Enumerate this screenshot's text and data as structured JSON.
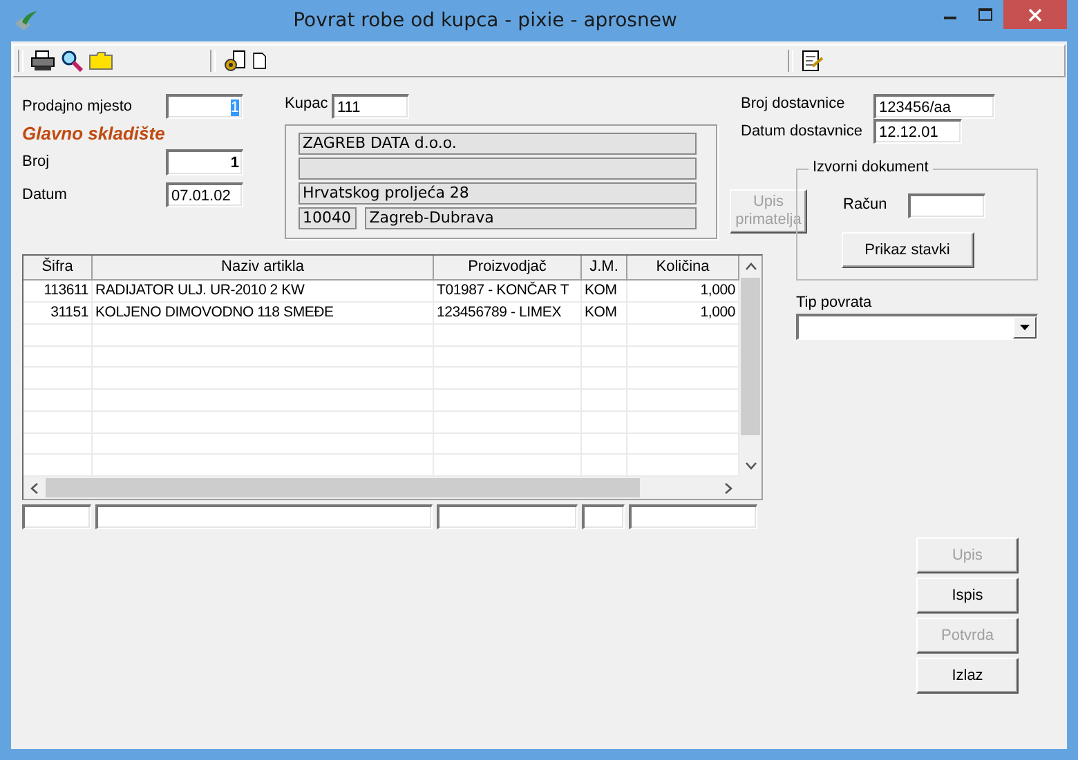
{
  "window": {
    "title": "Povrat robe od kupca - pixie - aprosnew"
  },
  "form": {
    "prodajno_mjesto": {
      "label": "Prodajno mjesto",
      "value": "1",
      "value_highlighted": true
    },
    "warehouse": "Glavno skladište",
    "broj": {
      "label": "Broj",
      "value": "1"
    },
    "datum": {
      "label": "Datum",
      "value": "07.01.02"
    },
    "kupac": {
      "label": "Kupac",
      "value": "111"
    }
  },
  "customer": {
    "name": "ZAGREB DATA d.o.o.",
    "address": "Hrvatskog proljeća 28",
    "postal_code": "10040",
    "city": "Zagreb-Dubrava"
  },
  "upis_primatelja": {
    "label": "Upis primatelja",
    "disabled": true
  },
  "delivery": {
    "broj": {
      "label": "Broj dostavnice",
      "value": "123456/aa"
    },
    "datum": {
      "label": "Datum dostavnice",
      "value": "12.12.01"
    }
  },
  "source_document": {
    "title": "Izvorni dokument",
    "racun_label": "Račun",
    "button": "Prikaz stavki"
  },
  "tip_povrata": {
    "label": "Tip povrata"
  },
  "table": {
    "columns": [
      "Šifra",
      "Naziv artikla",
      "Proizvodjač",
      "J.M.",
      "Količina"
    ],
    "rows": [
      [
        "113611",
        "RADIJATOR ULJ. UR-2010 2 KW",
        "T01987 - KONČAR T",
        "KOM",
        "1,000"
      ],
      [
        "31151",
        "KOLJENO DIMOVODNO 118 SMEĐE",
        "123456789 - LIMEX",
        "KOM",
        "1,000"
      ]
    ]
  },
  "buttons": [
    {
      "label": "Upis",
      "disabled": true
    },
    {
      "label": "Ispis",
      "disabled": false
    },
    {
      "label": "Potvrda",
      "disabled": true
    },
    {
      "label": "Izlaz",
      "disabled": false
    }
  ]
}
